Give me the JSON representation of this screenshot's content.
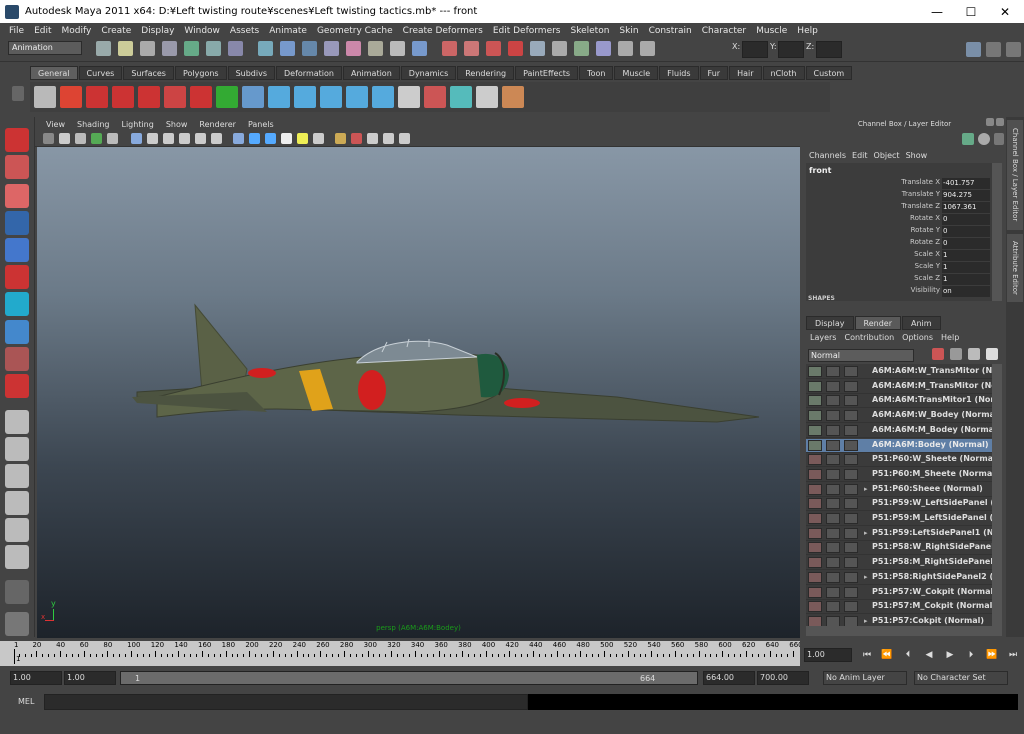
{
  "window": {
    "title": "Autodesk Maya 2011 x64: D:¥Left twisting route¥scenes¥Left twisting tactics.mb*   ---   front",
    "minimize": "—",
    "maximize": "☐",
    "close": "✕"
  },
  "menubar": [
    "File",
    "Edit",
    "Modify",
    "Create",
    "Display",
    "Window",
    "Assets",
    "Animate",
    "Geometry Cache",
    "Create Deformers",
    "Edit Deformers",
    "Skeleton",
    "Skin",
    "Constrain",
    "Character",
    "Muscle",
    "Help"
  ],
  "statusline": {
    "mode": "Animation",
    "x_label": "X:",
    "y_label": "Y:",
    "z_label": "Z:"
  },
  "shelf": {
    "tabs": [
      "General",
      "Curves",
      "Surfaces",
      "Polygons",
      "Subdivs",
      "Deformation",
      "Animation",
      "Dynamics",
      "Rendering",
      "PaintEffects",
      "Toon",
      "Muscle",
      "Fluids",
      "Fur",
      "Hair",
      "nCloth",
      "Custom"
    ],
    "active": "General"
  },
  "viewport": {
    "menu": [
      "View",
      "Shading",
      "Lighting",
      "Show",
      "Renderer",
      "Panels"
    ],
    "camera_label": "persp (A6M:A6M:Bodey)",
    "axis_y": "y",
    "axis_x": "x"
  },
  "channelbox": {
    "title": "Channel Box / Layer Editor",
    "menu": [
      "Channels",
      "Edit",
      "Object",
      "Show"
    ],
    "object": "front",
    "channels": [
      {
        "label": "Translate X",
        "value": "-401.757"
      },
      {
        "label": "Translate Y",
        "value": "904.275"
      },
      {
        "label": "Translate Z",
        "value": "1067.361"
      },
      {
        "label": "Rotate X",
        "value": "0"
      },
      {
        "label": "Rotate Y",
        "value": "0"
      },
      {
        "label": "Rotate Z",
        "value": "0"
      },
      {
        "label": "Scale X",
        "value": "1"
      },
      {
        "label": "Scale Y",
        "value": "1"
      },
      {
        "label": "Scale Z",
        "value": "1"
      },
      {
        "label": "Visibility",
        "value": "on"
      }
    ],
    "shapes_label": "SHAPES"
  },
  "sidetabs": {
    "channel": "Channel Box / Layer Editor",
    "attribute": "Attribute Editor"
  },
  "layers": {
    "tabs": [
      "Display",
      "Render",
      "Anim"
    ],
    "active": "Render",
    "menu": [
      "Layers",
      "Contribution",
      "Options",
      "Help"
    ],
    "blend_mode": "Normal",
    "rows": [
      {
        "name": "A6M:A6M:W_TransMitor (Normal)",
        "expand": false
      },
      {
        "name": "A6M:A6M:M_TransMitor (Normal)",
        "expand": false
      },
      {
        "name": "A6M:A6M:TransMitor1 (Normal)",
        "expand": false
      },
      {
        "name": "A6M:A6M:W_Bodey (Normal)",
        "expand": false
      },
      {
        "name": "A6M:A6M:M_Bodey (Normal)",
        "expand": false
      },
      {
        "name": "A6M:A6M:Bodey (Normal)",
        "expand": false,
        "selected": true
      },
      {
        "name": "P51:P60:W_Sheete (Normal)",
        "expand": false
      },
      {
        "name": "P51:P60:M_Sheete (Normal)",
        "expand": false
      },
      {
        "name": "P51:P60:Sheee (Normal)",
        "expand": true
      },
      {
        "name": "P51:P59:W_LeftSidePanel (No",
        "expand": false
      },
      {
        "name": "P51:P59:M_LeftSidePanel (No",
        "expand": false
      },
      {
        "name": "P51:P59:LeftSidePanel1 (Norm",
        "expand": true
      },
      {
        "name": "P51:P58:W_RightSidePanel (N",
        "expand": false
      },
      {
        "name": "P51:P58:M_RightSidePanel (N",
        "expand": false
      },
      {
        "name": "P51:P58:RightSidePanel2 (No",
        "expand": true
      },
      {
        "name": "P51:P57:W_Cokpit (Normal)",
        "expand": false
      },
      {
        "name": "P51:P57:M_Cokpit (Normal)",
        "expand": false
      },
      {
        "name": "P51:P57:Cokpit (Normal)",
        "expand": true
      }
    ]
  },
  "timeline": {
    "ticks": [
      "1",
      "20",
      "40",
      "60",
      "80",
      "100",
      "120",
      "140",
      "160",
      "180",
      "200",
      "220",
      "240",
      "260",
      "280",
      "300",
      "320",
      "340",
      "360",
      "380",
      "400",
      "420",
      "440",
      "460",
      "480",
      "500",
      "520",
      "540",
      "560",
      "580",
      "600",
      "620",
      "640",
      "660"
    ],
    "current_frame_field": "1.00",
    "current_marker": "1"
  },
  "range": {
    "start": "1.00",
    "playback_start": "1.00",
    "slider_start": "1",
    "slider_end": "664",
    "playback_end": "664.00",
    "end": "700.00",
    "anim_layer": "No Anim Layer",
    "character_set": "No Character Set"
  },
  "command": {
    "label": "MEL"
  },
  "colors": {
    "background": "#444444",
    "selected_layer": "#5f7fa6",
    "plane_body": "#5d6548",
    "hinomaru": "#d21f1f",
    "stripe": "#e0a21a"
  }
}
